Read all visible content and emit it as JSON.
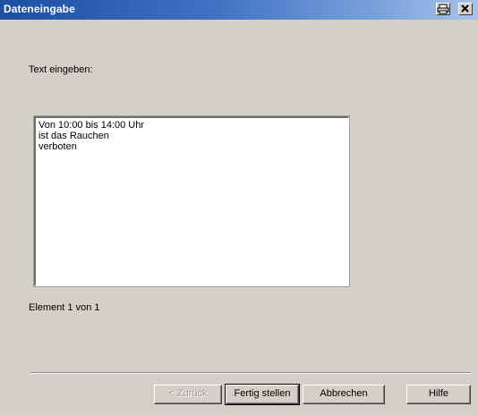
{
  "window": {
    "title": "Dateneingabe"
  },
  "dialog": {
    "prompt_label": "Text eingeben:",
    "text_lines": [
      "Von 10:00 bis 14:00 Uhr",
      "ist das Rauchen",
      "verboten"
    ],
    "status": "Element 1 von 1"
  },
  "buttons": {
    "back": "< Zurück",
    "finish": "Fertig stellen",
    "cancel": "Abbrechen",
    "help": "Hilfe"
  },
  "icons": {
    "titlebar_left": "print-icon",
    "titlebar_right": "close-icon"
  },
  "colors": {
    "titlebar": "#1c4fa0",
    "dialog_bg": "#d4d0c8"
  }
}
